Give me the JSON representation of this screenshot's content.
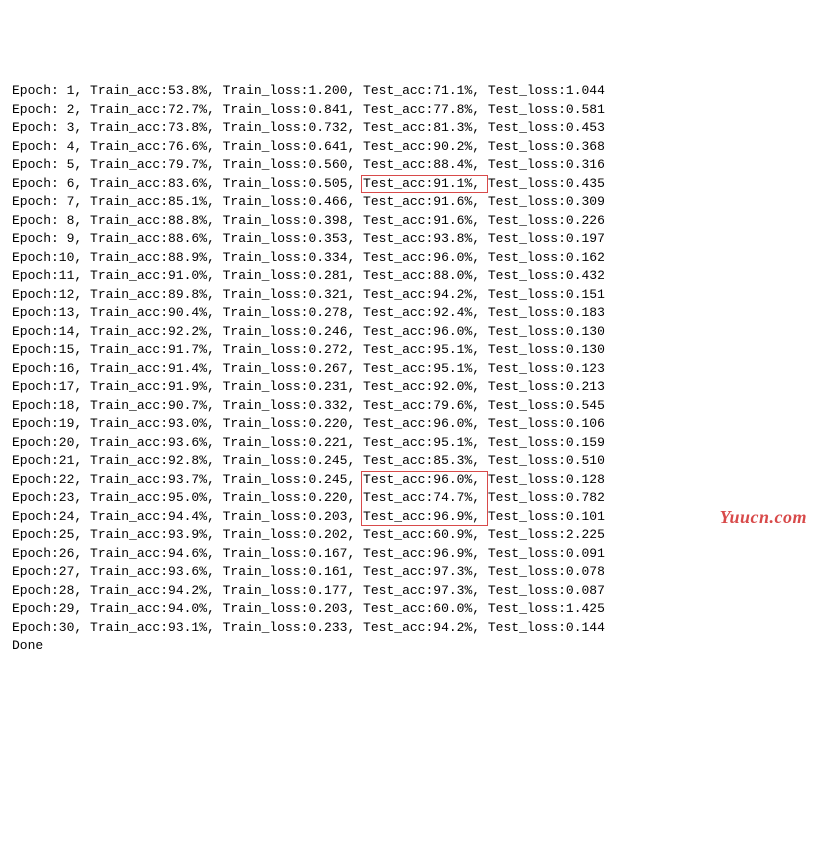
{
  "epochs": [
    {
      "e": " 1",
      "ta": "53.8%",
      "tl": "1.200",
      "va": "71.1%",
      "vl": "1.044"
    },
    {
      "e": " 2",
      "ta": "72.7%",
      "tl": "0.841",
      "va": "77.8%",
      "vl": "0.581"
    },
    {
      "e": " 3",
      "ta": "73.8%",
      "tl": "0.732",
      "va": "81.3%",
      "vl": "0.453"
    },
    {
      "e": " 4",
      "ta": "76.6%",
      "tl": "0.641",
      "va": "90.2%",
      "vl": "0.368"
    },
    {
      "e": " 5",
      "ta": "79.7%",
      "tl": "0.560",
      "va": "88.4%",
      "vl": "0.316"
    },
    {
      "e": " 6",
      "ta": "83.6%",
      "tl": "0.505",
      "va": "91.1%",
      "vl": "0.435"
    },
    {
      "e": " 7",
      "ta": "85.1%",
      "tl": "0.466",
      "va": "91.6%",
      "vl": "0.309"
    },
    {
      "e": " 8",
      "ta": "88.8%",
      "tl": "0.398",
      "va": "91.6%",
      "vl": "0.226"
    },
    {
      "e": " 9",
      "ta": "88.6%",
      "tl": "0.353",
      "va": "93.8%",
      "vl": "0.197"
    },
    {
      "e": "10",
      "ta": "88.9%",
      "tl": "0.334",
      "va": "96.0%",
      "vl": "0.162"
    },
    {
      "e": "11",
      "ta": "91.0%",
      "tl": "0.281",
      "va": "88.0%",
      "vl": "0.432"
    },
    {
      "e": "12",
      "ta": "89.8%",
      "tl": "0.321",
      "va": "94.2%",
      "vl": "0.151"
    },
    {
      "e": "13",
      "ta": "90.4%",
      "tl": "0.278",
      "va": "92.4%",
      "vl": "0.183"
    },
    {
      "e": "14",
      "ta": "92.2%",
      "tl": "0.246",
      "va": "96.0%",
      "vl": "0.130"
    },
    {
      "e": "15",
      "ta": "91.7%",
      "tl": "0.272",
      "va": "95.1%",
      "vl": "0.130"
    },
    {
      "e": "16",
      "ta": "91.4%",
      "tl": "0.267",
      "va": "95.1%",
      "vl": "0.123"
    },
    {
      "e": "17",
      "ta": "91.9%",
      "tl": "0.231",
      "va": "92.0%",
      "vl": "0.213"
    },
    {
      "e": "18",
      "ta": "90.7%",
      "tl": "0.332",
      "va": "79.6%",
      "vl": "0.545"
    },
    {
      "e": "19",
      "ta": "93.0%",
      "tl": "0.220",
      "va": "96.0%",
      "vl": "0.106"
    },
    {
      "e": "20",
      "ta": "93.6%",
      "tl": "0.221",
      "va": "95.1%",
      "vl": "0.159"
    },
    {
      "e": "21",
      "ta": "92.8%",
      "tl": "0.245",
      "va": "85.3%",
      "vl": "0.510"
    },
    {
      "e": "22",
      "ta": "93.7%",
      "tl": "0.245",
      "va": "96.0%",
      "vl": "0.128"
    },
    {
      "e": "23",
      "ta": "95.0%",
      "tl": "0.220",
      "va": "74.7%",
      "vl": "0.782"
    },
    {
      "e": "24",
      "ta": "94.4%",
      "tl": "0.203",
      "va": "96.9%",
      "vl": "0.101"
    },
    {
      "e": "25",
      "ta": "93.9%",
      "tl": "0.202",
      "va": "60.9%",
      "vl": "2.225"
    },
    {
      "e": "26",
      "ta": "94.6%",
      "tl": "0.167",
      "va": "96.9%",
      "vl": "0.091"
    },
    {
      "e": "27",
      "ta": "93.6%",
      "tl": "0.161",
      "va": "97.3%",
      "vl": "0.078"
    },
    {
      "e": "28",
      "ta": "94.2%",
      "tl": "0.177",
      "va": "97.3%",
      "vl": "0.087"
    },
    {
      "e": "29",
      "ta": "94.0%",
      "tl": "0.203",
      "va": "60.0%",
      "vl": "1.425"
    },
    {
      "e": "30",
      "ta": "93.1%",
      "tl": "0.233",
      "va": "94.2%",
      "vl": "0.144"
    }
  ],
  "labels": {
    "epoch": "Epoch:",
    "train_acc": "Train_acc:",
    "train_loss": "Train_loss:",
    "test_acc": "Test_acc:",
    "test_loss": "Test_loss:",
    "done": "Done"
  },
  "watermark": "Yuucn.com",
  "highlight_color": "#d84a4a",
  "highlights": [
    {
      "line": 10,
      "single": true
    },
    {
      "line": 26,
      "span": 3
    }
  ]
}
